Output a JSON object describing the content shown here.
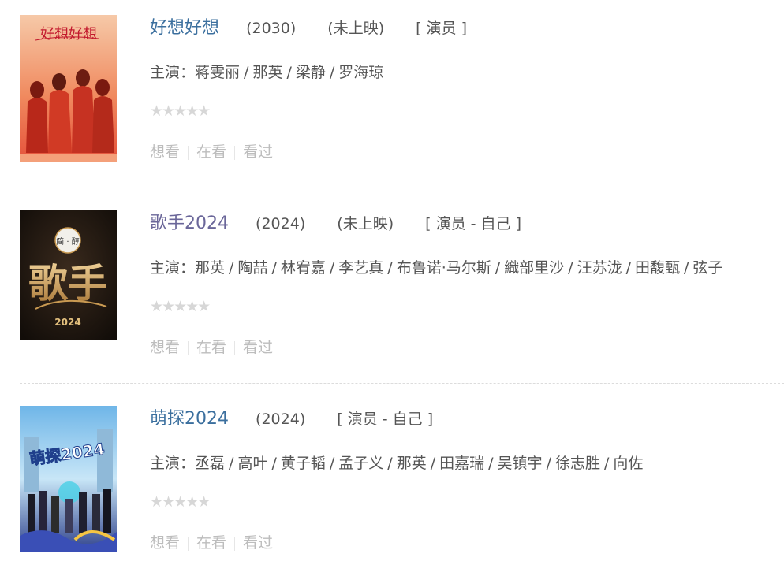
{
  "items": [
    {
      "title": "好想好想",
      "year": "(2030)",
      "status": "(未上映)",
      "role": "[ 演员 ]",
      "cast_prefix": "主演：",
      "cast": [
        "蒋雯丽",
        "那英",
        "梁静",
        "罗海琼"
      ],
      "stars": "★★★★★",
      "actions": [
        "想看",
        "在看",
        "看过"
      ],
      "poster_text": "好想好想",
      "poster_colors": {
        "bg_top": "#f6c9a8",
        "bg_mid": "#f08a5f",
        "bg_bottom": "#e5523b",
        "accent": "#c2182d"
      }
    },
    {
      "title": "歌手2024",
      "year": "(2024)",
      "status": "(未上映)",
      "role": "[ 演员 - 自己 ]",
      "cast_prefix": "主演：",
      "cast": [
        "那英",
        "陶喆",
        "林宥嘉",
        "李艺真",
        "布鲁诺·马尔斯",
        "織部里沙",
        "汪苏泷",
        "田馥甄",
        "弦子"
      ],
      "stars": "★★★★★",
      "actions": [
        "想看",
        "在看",
        "看过"
      ],
      "poster_text": "歌手",
      "poster_subtext": "2024",
      "poster_badge": "简 · 醇",
      "poster_colors": {
        "bg": "#1b1410",
        "gold": "#c99a52",
        "gold_light": "#f1d39a"
      }
    },
    {
      "title": "萌探2024",
      "year": "(2024)",
      "status": "",
      "role": "[ 演员 - 自己 ]",
      "cast_prefix": "主演：",
      "cast": [
        "丞磊",
        "高叶",
        "黄子韬",
        "孟子义",
        "那英",
        "田嘉瑞",
        "吴镇宇",
        "徐志胜",
        "向佐"
      ],
      "stars": "★★★★★",
      "actions": [
        "想看",
        "在看",
        "看过"
      ],
      "poster_text": "萌探2024",
      "poster_colors": {
        "sky": "#6fb6e8",
        "sky_light": "#c8e6f7",
        "ground": "#2d3f8a",
        "accent": "#4fd0e6"
      }
    }
  ],
  "colors": {
    "title_blue": "#3b6f9e",
    "text": "#555555",
    "muted": "#bdbdbd",
    "star_empty": "#d7d7d7",
    "divider": "#dcdcdc"
  }
}
